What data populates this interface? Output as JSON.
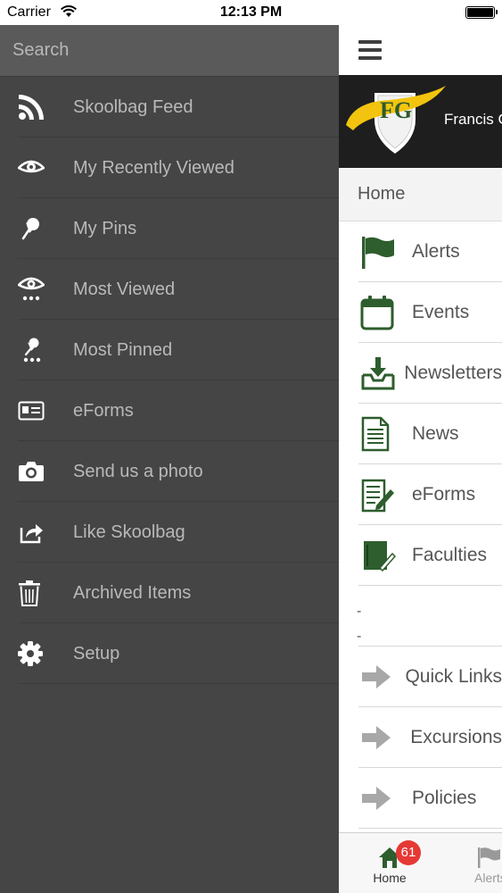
{
  "status_bar": {
    "carrier": "Carrier",
    "time": "12:13 PM"
  },
  "search": {
    "placeholder": "Search"
  },
  "side_menu": {
    "items": [
      {
        "label": "Skoolbag Feed",
        "icon": "rss-icon"
      },
      {
        "label": "My Recently Viewed",
        "icon": "eye-icon"
      },
      {
        "label": "My Pins",
        "icon": "pin-icon"
      },
      {
        "label": "Most Viewed",
        "icon": "eye-dots-icon"
      },
      {
        "label": "Most Pinned",
        "icon": "pin-dots-icon"
      },
      {
        "label": "eForms",
        "icon": "id-card-icon"
      },
      {
        "label": "Send us a photo",
        "icon": "camera-icon"
      },
      {
        "label": "Like Skoolbag",
        "icon": "share-icon"
      },
      {
        "label": "Archived Items",
        "icon": "trash-icon"
      },
      {
        "label": "Setup",
        "icon": "gear-icon"
      }
    ]
  },
  "main": {
    "banner": {
      "logo_text": "FG",
      "school_name": "Francis G"
    },
    "home_title": "Home",
    "items": [
      {
        "label": "Alerts",
        "icon": "flag-icon"
      },
      {
        "label": "Events",
        "icon": "calendar-icon"
      },
      {
        "label": "Newsletters",
        "icon": "inbox-download-icon"
      },
      {
        "label": "News",
        "icon": "document-icon"
      },
      {
        "label": "eForms",
        "icon": "form-pen-icon"
      },
      {
        "label": "Faculties",
        "icon": "notebook-pen-icon"
      }
    ],
    "dashes": [
      "-",
      "-"
    ],
    "links": [
      {
        "label": "Quick Links",
        "icon": "arrow-right-icon"
      },
      {
        "label": "Excursions",
        "icon": "arrow-right-icon"
      },
      {
        "label": "Policies",
        "icon": "arrow-right-icon"
      }
    ]
  },
  "tab_bar": {
    "home_label": "Home",
    "home_badge": "61",
    "alerts_label": "Alerts"
  },
  "colors": {
    "menu_background": "#454545",
    "icon_green": "#2e5d2e",
    "badge_red": "#e53935",
    "logo_yellow": "#f2c40f"
  }
}
